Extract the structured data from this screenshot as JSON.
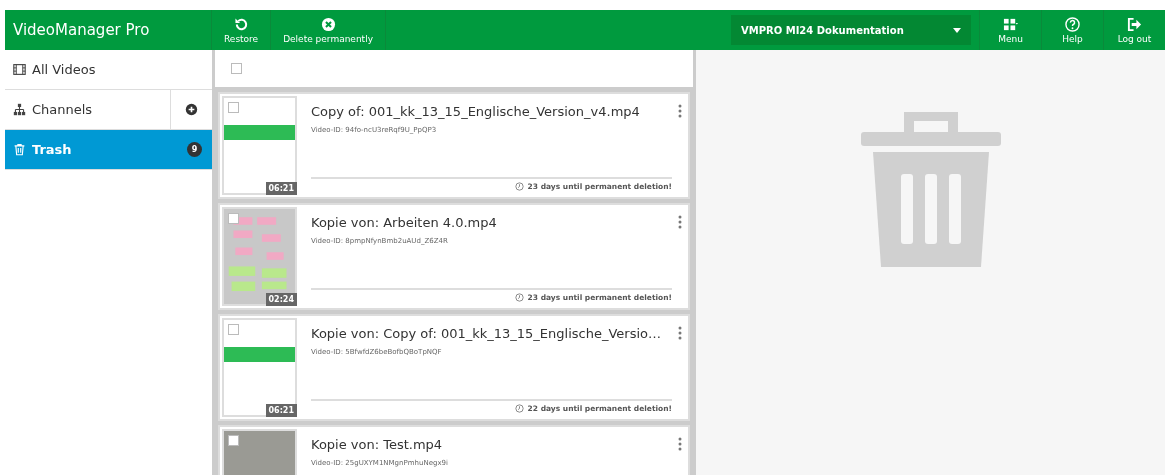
{
  "app": {
    "title": "VideoManager Pro"
  },
  "toolbar": [
    {
      "label": "Restore"
    },
    {
      "label": "Delete permanently"
    }
  ],
  "project_select": {
    "value": "VMPRO MI24 Dokumentation"
  },
  "top_actions": [
    {
      "label": "Menu"
    },
    {
      "label": "Help"
    },
    {
      "label": "Log out"
    }
  ],
  "sidebar": {
    "items": [
      {
        "label": "All Videos",
        "selected": false
      },
      {
        "label": "Channels",
        "selected": false,
        "add_button": true
      },
      {
        "label": "Trash",
        "selected": true,
        "count": "9"
      }
    ]
  },
  "list": {
    "select_all": {
      "checked": false
    },
    "videos": [
      {
        "title": "Copy of: 001_kk_13_15_Englische_Version_v4.mp4",
        "video_id": "Video-ID: 94fo-ncU3reRqf9U_PpQP3",
        "duration": "06:21",
        "deletion": "23 days until permanent deletion!",
        "checked": false,
        "kind": "slide"
      },
      {
        "title": "Kopie von: Arbeiten 4.0.mp4",
        "video_id": "Video-ID: 8pmpNfynBmb2uAUd_Z6Z4R",
        "duration": "02:24",
        "deletion": "23 days until permanent deletion!",
        "checked": false,
        "kind": "notes"
      },
      {
        "title": "Kopie von: Copy of: 001_kk_13_15_Englische_Versio…",
        "video_id": "Video-ID: 5BfwfdZ6beBofbQBoTpNQF",
        "duration": "06:21",
        "deletion": "22 days until permanent deletion!",
        "checked": false,
        "kind": "slide"
      },
      {
        "title": "Kopie von: Test.mp4",
        "video_id": "Video-ID: 25gUXYM1NMgnPmhuNegx9i",
        "checked": false,
        "kind": "people"
      }
    ]
  }
}
